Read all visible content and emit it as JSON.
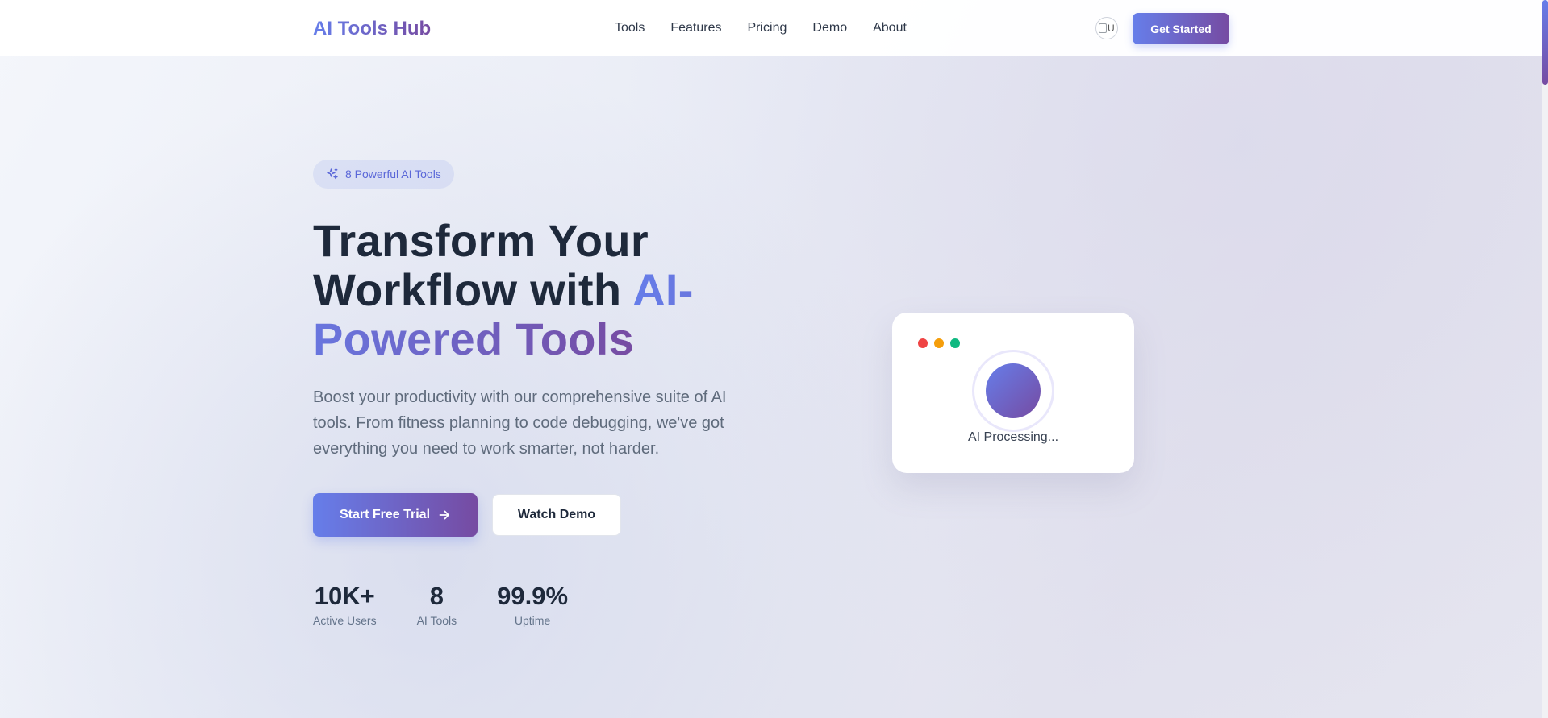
{
  "brand": "AI Tools Hub",
  "nav": {
    "links": [
      "Tools",
      "Features",
      "Pricing",
      "Demo",
      "About"
    ],
    "avatar_alt": "U",
    "cta_label": "Get Started"
  },
  "hero": {
    "badge": "8 Powerful AI Tools",
    "headline_part1": "Transform Your Workflow with ",
    "headline_accent": "AI-Powered Tools",
    "description": "Boost your productivity with our comprehensive suite of AI tools. From fitness planning to code debugging, we've got everything you need to work smarter, not harder.",
    "primary_cta": "Start Free Trial",
    "secondary_cta": "Watch Demo",
    "stats": [
      {
        "value": "10K+",
        "label": "Active Users"
      },
      {
        "value": "8",
        "label": "AI Tools"
      },
      {
        "value": "99.9%",
        "label": "Uptime"
      }
    ]
  },
  "preview": {
    "status_text": "AI Processing..."
  },
  "colors": {
    "accent_start": "#667eea",
    "accent_end": "#764ba2",
    "heading": "#1e293b",
    "window_dot_red": "#ef4444",
    "window_dot_yellow": "#f59e0b",
    "window_dot_green": "#10b981"
  },
  "icons": {
    "badge_icon": "sparkles-icon",
    "primary_cta_icon": "arrow-right-icon"
  }
}
